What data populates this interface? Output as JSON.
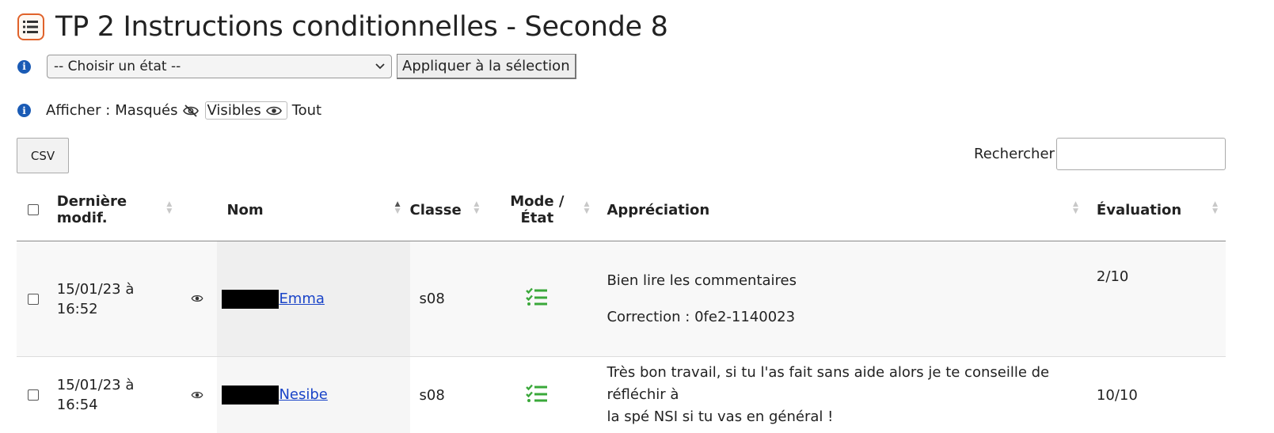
{
  "page": {
    "title": "TP 2 Instructions conditionnelles - Seconde 8"
  },
  "state_bar": {
    "select_value": "-- Choisir un état --",
    "apply_label": "Appliquer à la sélection"
  },
  "filter": {
    "label": "Afficher :",
    "hidden": "Masqués",
    "visible": "Visibles",
    "all": "Tout"
  },
  "toolbar": {
    "csv_label": "CSV",
    "search_label": "Rechercher",
    "search_value": ""
  },
  "table": {
    "headers": {
      "last_modified_line1": "Dernière",
      "last_modified_line2": "modif.",
      "name": "Nom",
      "class": "Classe",
      "mode_line1": "Mode /",
      "mode_line2": "État",
      "appreciation": "Appréciation",
      "evaluation": "Évaluation"
    },
    "rows": [
      {
        "date_line1": "15/01/23 à",
        "date_line2": "16:52",
        "name": "Emma",
        "class": "s08",
        "appreciation": "Bien lire les commentaires",
        "appreciation_2": "Correction : 0fe2-1140023",
        "evaluation": "2/10"
      },
      {
        "date_line1": "15/01/23 à",
        "date_line2": "16:54",
        "name": "Nesibe",
        "class": "s08",
        "appreciation": "Très bon travail, si tu l'as fait sans aide alors je te conseille de réfléchir à",
        "appreciation_2": "la spé NSI si tu vas en général !",
        "evaluation": "10/10"
      }
    ]
  },
  "colors": {
    "accent": "#1a5bb5",
    "link": "#1a44c8",
    "status_green": "#3aa83a",
    "title_icon": "#e0622a"
  },
  "icons": {
    "title": "list-icon",
    "info": "info-icon",
    "eye": "eye-icon",
    "eye_slash": "eye-slash-icon",
    "mode": "checklist-icon"
  }
}
